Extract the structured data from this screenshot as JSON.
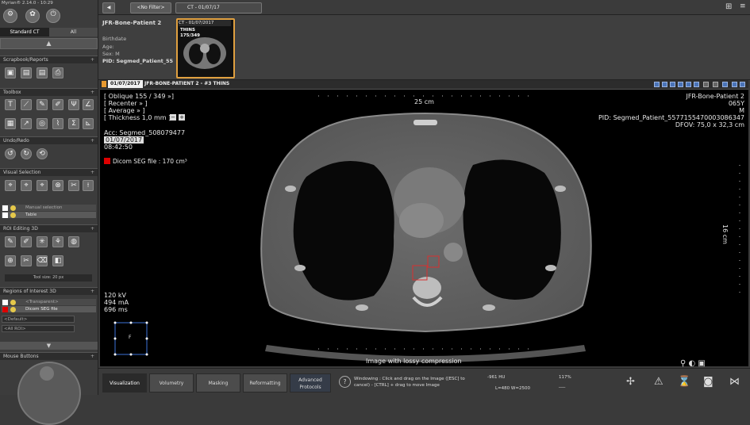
{
  "app": {
    "title": "Myrian® 2.14.0 - 10:29"
  },
  "left_panel": {
    "tabs": [
      "Standard CT",
      "All"
    ],
    "sections": {
      "scrapbook": "Scrapbook/Reports",
      "toolbox": "Toolbox",
      "undo": "Undo/Redo",
      "visual_selection": "Visual Selection",
      "roi_editing": "ROI Editing 3D",
      "roi_3d": "Regions of Interest 3D",
      "mouse": "Mouse Buttons"
    },
    "visual_selection_rows": [
      "Manual selection",
      "Table"
    ],
    "tool_size": "Tool size: 20 px",
    "roi_rows": [
      "<Transparent>",
      "Dicom SEG file"
    ],
    "roi_default": "<Default>",
    "roi_all": "<All ROI>",
    "colors": {
      "roi_red": "#dd0000",
      "roi_white": "#ffffff"
    }
  },
  "topbar": {
    "filter": "<No Filter>",
    "series_tab": "CT - 01/07/17"
  },
  "patient": {
    "name": "JFR-Bone-Patient 2",
    "birthdate": "Birthdate",
    "age": "Age:",
    "sex": "Sex: M",
    "pid": "PID: Segmed_Patient_55"
  },
  "thumbnail": {
    "label": "CT - 01/07/2017",
    "series": "THINS",
    "count": "175/349"
  },
  "viewer_header": {
    "date": "01/07/2017",
    "title": "JFR-BONE-PATIENT 2 - #3 THINS"
  },
  "overlay": {
    "tl": [
      "[ Oblique 155 / 349 »]",
      "[ Recenter » ]",
      "[ Average » ]",
      "[ Thickness 1,0 mm ]"
    ],
    "acc": "Acc: Segmed_508079477",
    "date": "01/07/2017",
    "time": "08:42:50",
    "seg": "Dicom SEG file : 170 cm³",
    "tr": [
      "JFR-Bone-Patient 2",
      "065Y",
      "M",
      "PID: Segmed_Patient_5577155470003086347",
      "DFOV: 75,0 x 32,3 cm"
    ],
    "ruler_top": "25 cm",
    "ruler_right": "16 cm",
    "bl": [
      "120 kV",
      "494 mA",
      "696 ms"
    ],
    "orientation": "F",
    "compression": "Image with lossy compression"
  },
  "bottom": {
    "tabs": [
      "Visualization",
      "Volumetry",
      "Masking",
      "Reformatting",
      "Advanced Protocols"
    ],
    "help": "Windowing : Click and drag on the Image ([ESC] to cancel) - [CTRL] + drag to move Image",
    "hu": "-961 HU",
    "zoom": "117%",
    "window": "L=480 W=2500",
    "dashes": "___"
  }
}
